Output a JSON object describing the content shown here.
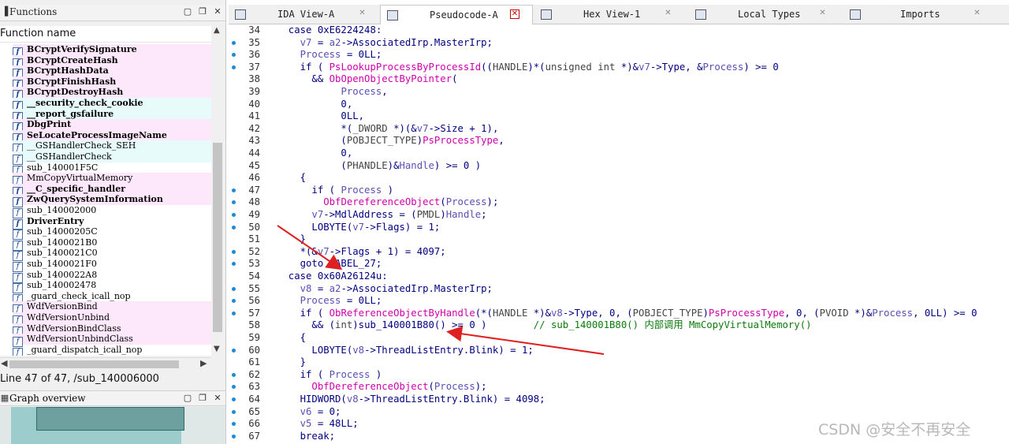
{
  "functions_panel": {
    "title": "Functions",
    "column_header": "Function name",
    "items": [
      {
        "name": "BCryptVerifySignature",
        "style": "bold",
        "bg": "pink"
      },
      {
        "name": "BCryptCreateHash",
        "style": "bold",
        "bg": "pink"
      },
      {
        "name": "BCryptHashData",
        "style": "bold",
        "bg": "pink"
      },
      {
        "name": "BCryptFinishHash",
        "style": "bold",
        "bg": "pink"
      },
      {
        "name": "BCryptDestroyHash",
        "style": "bold",
        "bg": "pink"
      },
      {
        "name": "__security_check_cookie",
        "style": "bold",
        "bg": "cyan"
      },
      {
        "name": "__report_gsfailure",
        "style": "bold",
        "bg": "cyan"
      },
      {
        "name": "DbgPrint",
        "style": "bold",
        "bg": "pink"
      },
      {
        "name": "SeLocateProcessImageName",
        "style": "bold",
        "bg": "pink"
      },
      {
        "name": "__GSHandlerCheck_SEH",
        "style": "norm",
        "bg": "cyan"
      },
      {
        "name": "__GSHandlerCheck",
        "style": "norm",
        "bg": "cyan"
      },
      {
        "name": "sub_140001F5C",
        "style": "norm",
        "bg": "none"
      },
      {
        "name": "MmCopyVirtualMemory",
        "style": "norm",
        "bg": "pink"
      },
      {
        "name": "__C_specific_handler",
        "style": "bold",
        "bg": "pink"
      },
      {
        "name": "ZwQuerySystemInformation",
        "style": "bold",
        "bg": "pink"
      },
      {
        "name": "sub_140002000",
        "style": "norm",
        "bg": "none"
      },
      {
        "name": "DriverEntry",
        "style": "bold",
        "bg": "none"
      },
      {
        "name": "sub_14000205C",
        "style": "norm",
        "bg": "none"
      },
      {
        "name": "sub_1400021B0",
        "style": "norm",
        "bg": "none"
      },
      {
        "name": "sub_1400021C0",
        "style": "norm",
        "bg": "none"
      },
      {
        "name": "sub_1400021F0",
        "style": "norm",
        "bg": "none"
      },
      {
        "name": "sub_1400022A8",
        "style": "norm",
        "bg": "none"
      },
      {
        "name": "sub_140002478",
        "style": "norm",
        "bg": "none"
      },
      {
        "name": "_guard_check_icall_nop",
        "style": "norm",
        "bg": "none"
      },
      {
        "name": "WdfVersionBind",
        "style": "norm",
        "bg": "pink"
      },
      {
        "name": "WdfVersionUnbind",
        "style": "norm",
        "bg": "pink"
      },
      {
        "name": "WdfVersionBindClass",
        "style": "norm",
        "bg": "pink"
      },
      {
        "name": "WdfVersionUnbindClass",
        "style": "norm",
        "bg": "pink"
      },
      {
        "name": "_guard_dispatch_icall_nop",
        "style": "norm",
        "bg": "none"
      }
    ],
    "line_info": "Line 47 of 47, /sub_140006000"
  },
  "graph_overview": {
    "title": "Graph overview"
  },
  "tabs": [
    {
      "label": "IDA View-A",
      "active": false
    },
    {
      "label": "Pseudocode-A",
      "active": true
    },
    {
      "label": "Hex View-1",
      "active": false
    },
    {
      "label": "Local Types",
      "active": false
    },
    {
      "label": "Imports",
      "active": false
    }
  ],
  "code_lines": [
    {
      "n": "34",
      "dot": false,
      "html": "  case 0xE6224248:"
    },
    {
      "n": "35",
      "dot": true,
      "html": "    <span class=\"v\">v7</span> = <span class=\"v\">a2</span>-&gt;AssociatedIrp.MasterIrp;"
    },
    {
      "n": "36",
      "dot": true,
      "html": "    <span class=\"v\">Process</span> = 0LL;"
    },
    {
      "n": "37",
      "dot": true,
      "html": "    if ( <span class=\"fn\">PsLookupProcessByProcessId</span>((<span class=\"gr\">HANDLE</span>)*(<span class=\"gr\">unsigned int</span> *)&amp;<span class=\"v\">v7</span>-&gt;Type, &amp;<span class=\"v\">Process</span>) &gt;= 0"
    },
    {
      "n": "38",
      "dot": false,
      "html": "      &amp;&amp; <span class=\"fn\">ObOpenObjectByPointer</span>("
    },
    {
      "n": "39",
      "dot": false,
      "html": "           <span class=\"v\">Process</span>,"
    },
    {
      "n": "40",
      "dot": false,
      "html": "           0,"
    },
    {
      "n": "41",
      "dot": false,
      "html": "           0LL,"
    },
    {
      "n": "42",
      "dot": false,
      "html": "           *(<span class=\"gr\">_DWORD</span> *)(&amp;<span class=\"v\">v7</span>-&gt;Size + 1),"
    },
    {
      "n": "43",
      "dot": false,
      "html": "           (<span class=\"gr\">POBJECT_TYPE</span>)<span class=\"fn\">PsProcessType</span>,"
    },
    {
      "n": "44",
      "dot": false,
      "html": "           0,"
    },
    {
      "n": "45",
      "dot": false,
      "html": "           (<span class=\"gr\">PHANDLE</span>)&amp;<span class=\"v\">Handle</span>) &gt;= 0 )"
    },
    {
      "n": "46",
      "dot": false,
      "html": "    {"
    },
    {
      "n": "47",
      "dot": true,
      "html": "      if ( <span class=\"v\">Process</span> )"
    },
    {
      "n": "48",
      "dot": true,
      "html": "        <span class=\"fn\">ObfDereferenceObject</span>(<span class=\"v\">Process</span>);"
    },
    {
      "n": "49",
      "dot": true,
      "html": "      <span class=\"v\">v7</span>-&gt;MdlAddress = (<span class=\"gr\">PMDL</span>)<span class=\"v\">Handle</span>;"
    },
    {
      "n": "50",
      "dot": true,
      "html": "      LOBYTE(<span class=\"v\">v7</span>-&gt;Flags) = 1;"
    },
    {
      "n": "51",
      "dot": false,
      "html": "    }"
    },
    {
      "n": "52",
      "dot": true,
      "html": "    *(&amp;<span class=\"v\">v7</span>-&gt;Flags + 1) = 4097;"
    },
    {
      "n": "53",
      "dot": true,
      "html": "    goto LABEL_27;"
    },
    {
      "n": "54",
      "dot": false,
      "html": "  case 0x60A26124u:"
    },
    {
      "n": "55",
      "dot": true,
      "html": "    <span class=\"v\">v8</span> = <span class=\"v\">a2</span>-&gt;AssociatedIrp.MasterIrp;"
    },
    {
      "n": "56",
      "dot": true,
      "html": "    <span class=\"v\">Process</span> = 0LL;"
    },
    {
      "n": "57",
      "dot": true,
      "html": "    if ( <span class=\"fn\">ObReferenceObjectByHandle</span>(*(<span class=\"gr\">HANDLE</span> *)&amp;<span class=\"v\">v8</span>-&gt;Type, 0, (<span class=\"gr\">POBJECT_TYPE</span>)<span class=\"fn\">PsProcessType</span>, 0, (<span class=\"gr\">PVOID</span> *)&amp;<span class=\"v\">Process</span>, 0LL) &gt;= 0"
    },
    {
      "n": "58",
      "dot": false,
      "html": "      &amp;&amp; (<span class=\"gr\">int</span>)sub_140001B80() &gt;= 0 )        <span class=\"cmt\">// sub_140001B80() 内部调用 MmCopyVirtualMemory()</span>"
    },
    {
      "n": "59",
      "dot": false,
      "html": "    {"
    },
    {
      "n": "60",
      "dot": true,
      "html": "      LOBYTE(<span class=\"v\">v8</span>-&gt;ThreadListEntry.Blink) = 1;"
    },
    {
      "n": "61",
      "dot": false,
      "html": "    }"
    },
    {
      "n": "62",
      "dot": true,
      "html": "    if ( <span class=\"v\">Process</span> )"
    },
    {
      "n": "63",
      "dot": true,
      "html": "      <span class=\"fn\">ObfDereferenceObject</span>(<span class=\"v\">Process</span>);"
    },
    {
      "n": "64",
      "dot": true,
      "html": "    HIDWORD(<span class=\"v\">v8</span>-&gt;ThreadListEntry.Blink) = 4098;"
    },
    {
      "n": "65",
      "dot": true,
      "html": "    <span class=\"v\">v6</span> = 0;"
    },
    {
      "n": "66",
      "dot": true,
      "html": "    <span class=\"v\">v5</span> = 48LL;"
    },
    {
      "n": "67",
      "dot": true,
      "html": "    break;"
    }
  ],
  "watermark": "CSDN @安全不再安全",
  "colors": {
    "keyword": "#000080",
    "variable": "#5a4fb3",
    "function": "#d100a9",
    "comment": "#0b7a0b",
    "arrow": "#e02020",
    "dot": "#1c8ad8"
  }
}
